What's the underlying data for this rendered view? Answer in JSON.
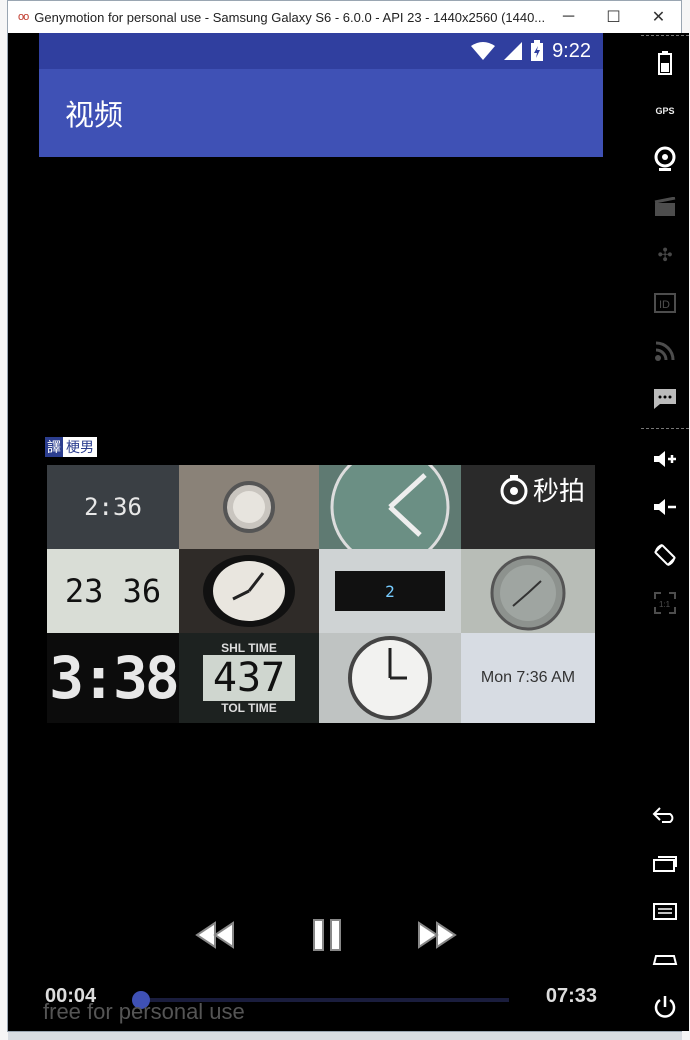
{
  "window": {
    "title": "Genymotion for personal use - Samsung Galaxy S6 - 6.0.0 - API 23 - 1440x2560 (1440...",
    "buttons": {
      "minimize": "─",
      "maximize": "☐",
      "close": "✕"
    }
  },
  "statusbar": {
    "time": "9:22"
  },
  "appbar": {
    "title": "视频"
  },
  "video": {
    "subtitle_tag": "譯",
    "subtitle_text": "梗男",
    "logo_text": "秒拍",
    "frames": {
      "clock_236": "2:36",
      "lcd_2336": "23 36",
      "big_338": "3:38",
      "score_437": "437",
      "score_label_top": "SHL TIME",
      "score_label_bottom": "TOL TIME",
      "mini_digit": "2",
      "mon_time": "Mon 7:36 AM"
    }
  },
  "player": {
    "current_time": "00:04",
    "total_time": "07:33",
    "progress_fraction": 0.01,
    "play_state": "playing"
  },
  "watermark": "free for personal use",
  "colors": {
    "primary": "#3f51b5",
    "primary_dark": "#303f9f"
  }
}
